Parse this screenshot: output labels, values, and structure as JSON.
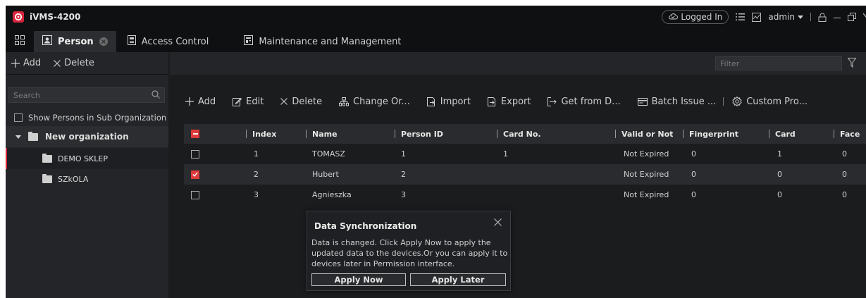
{
  "window": {
    "title": "iVMS-4200",
    "logged_in": "Logged In",
    "user": "admin"
  },
  "tabs": [
    {
      "label": "Person",
      "active": true
    },
    {
      "label": "Access Control"
    },
    {
      "label": "Maintenance and Management"
    }
  ],
  "left_panel": {
    "add_label": "Add",
    "delete_label": "Delete",
    "search_placeholder": "Search",
    "show_sub_label": "Show Persons in Sub Organization",
    "tree": {
      "root": "New organization",
      "children": [
        "DEMO SKLEP",
        "SZkOLA"
      ]
    }
  },
  "main": {
    "filter_placeholder": "Filter",
    "actions": {
      "add": "Add",
      "edit": "Edit",
      "delete": "Delete",
      "change_org": "Change Or...",
      "import": "Import",
      "export": "Export",
      "get_from_device": "Get from D...",
      "batch_issue": "Batch Issue ...",
      "custom_prop": "Custom Pro..."
    },
    "table": {
      "headers": {
        "index": "Index",
        "name": "Name",
        "person_id": "Person ID",
        "card_no": "Card No.",
        "valid": "Valid or Not",
        "fingerprint": "Fingerprint",
        "card": "Card",
        "face": "Face"
      },
      "rows": [
        {
          "checked": false,
          "index": "1",
          "name": "TOMASZ",
          "person_id": "1",
          "card_no": "1",
          "valid": "Not Expired",
          "fingerprint": "0",
          "card": "1",
          "face": "0"
        },
        {
          "checked": true,
          "index": "2",
          "name": "Hubert",
          "person_id": "2",
          "card_no": "",
          "valid": "Not Expired",
          "fingerprint": "0",
          "card": "0",
          "face": "0"
        },
        {
          "checked": false,
          "index": "3",
          "name": "Agnieszka",
          "person_id": "3",
          "card_no": "",
          "valid": "Not Expired",
          "fingerprint": "0",
          "card": "0",
          "face": "0"
        }
      ]
    }
  },
  "popup": {
    "title": "Data Synchronization",
    "message": "Data is changed. Click Apply Now to apply the updated data to the devices.Or you can apply it to devices later in Permission interface.",
    "apply_now": "Apply Now",
    "apply_later": "Apply Later"
  },
  "colors": {
    "accent": "#e03a3a",
    "background": "#1b1c1e",
    "panel": "#242528"
  }
}
